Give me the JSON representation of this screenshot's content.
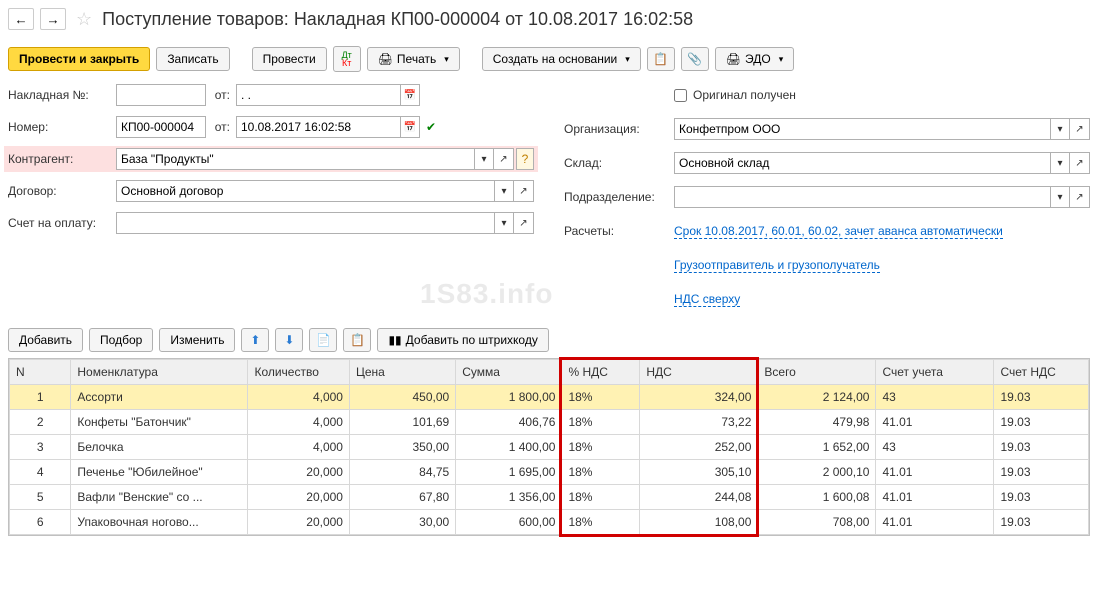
{
  "title": "Поступление товаров: Накладная КП00-000004 от 10.08.2017 16:02:58",
  "toolbar": {
    "post_close": "Провести и закрыть",
    "save": "Записать",
    "post": "Провести",
    "print": "Печать",
    "create_based": "Создать на основании",
    "edo": "ЭДО"
  },
  "form": {
    "invoice_no_label": "Накладная №:",
    "invoice_no": "",
    "from1_label": "от:",
    "invoice_date": ". .",
    "number_label": "Номер:",
    "number": "КП00-000004",
    "from2_label": "от:",
    "date": "10.08.2017 16:02:58",
    "counterparty_label": "Контрагент:",
    "counterparty": "База \"Продукты\"",
    "contract_label": "Договор:",
    "contract": "Основной договор",
    "bill_label": "Счет на оплату:",
    "bill": "",
    "original_label": "Оригинал получен",
    "org_label": "Организация:",
    "org": "Конфетпром ООО",
    "warehouse_label": "Склад:",
    "warehouse": "Основной склад",
    "division_label": "Подразделение:",
    "division": "",
    "calc_label": "Расчеты:",
    "calc_link": "Срок 10.08.2017, 60.01, 60.02, зачет аванса автоматически",
    "shipper_link": "Грузоотправитель и грузополучатель",
    "vat_link": "НДС сверху"
  },
  "table_toolbar": {
    "add": "Добавить",
    "pick": "Подбор",
    "edit": "Изменить",
    "barcode": "Добавить по штрихкоду"
  },
  "columns": [
    "N",
    "Номенклатура",
    "Количество",
    "Цена",
    "Сумма",
    "% НДС",
    "НДС",
    "Всего",
    "Счет учета",
    "Счет НДС"
  ],
  "rows": [
    {
      "n": "1",
      "nom": "Ассорти",
      "qty": "4,000",
      "price": "450,00",
      "sum": "1 800,00",
      "vatp": "18%",
      "vat": "324,00",
      "total": "2 124,00",
      "acc": "43",
      "vacc": "19.03"
    },
    {
      "n": "2",
      "nom": "Конфеты \"Батончик\"",
      "qty": "4,000",
      "price": "101,69",
      "sum": "406,76",
      "vatp": "18%",
      "vat": "73,22",
      "total": "479,98",
      "acc": "41.01",
      "vacc": "19.03"
    },
    {
      "n": "3",
      "nom": "Белочка",
      "qty": "4,000",
      "price": "350,00",
      "sum": "1 400,00",
      "vatp": "18%",
      "vat": "252,00",
      "total": "1 652,00",
      "acc": "43",
      "vacc": "19.03"
    },
    {
      "n": "4",
      "nom": "Печенье \"Юбилейное\"",
      "qty": "20,000",
      "price": "84,75",
      "sum": "1 695,00",
      "vatp": "18%",
      "vat": "305,10",
      "total": "2 000,10",
      "acc": "41.01",
      "vacc": "19.03"
    },
    {
      "n": "5",
      "nom": "Вафли \"Венские\" со ...",
      "qty": "20,000",
      "price": "67,80",
      "sum": "1 356,00",
      "vatp": "18%",
      "vat": "244,08",
      "total": "1 600,08",
      "acc": "41.01",
      "vacc": "19.03"
    },
    {
      "n": "6",
      "nom": "Упаковочная ногово...",
      "qty": "20,000",
      "price": "30,00",
      "sum": "600,00",
      "vatp": "18%",
      "vat": "108,00",
      "total": "708,00",
      "acc": "41.01",
      "vacc": "19.03"
    }
  ],
  "watermark": "1S83.info"
}
